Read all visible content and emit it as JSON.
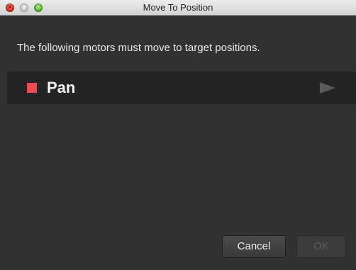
{
  "window": {
    "title": "Move To Position"
  },
  "message": "The following motors must move to target positions.",
  "motors": [
    {
      "name": "Pan",
      "color": "#f04a55",
      "action_icon": "play-arrow-icon"
    }
  ],
  "buttons": {
    "cancel_label": "Cancel",
    "ok_label": "OK",
    "ok_enabled": false
  },
  "colors": {
    "window_background": "#323232",
    "row_background": "#242424",
    "close_button": "#d2261a",
    "maximize_button": "#4ea92b"
  }
}
